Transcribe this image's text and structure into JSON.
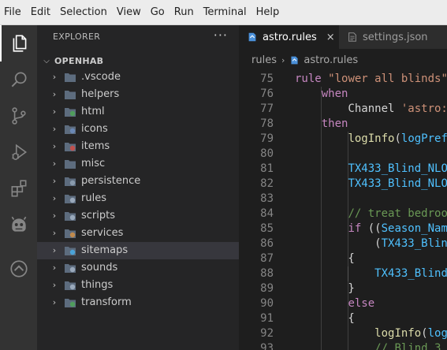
{
  "menubar": {
    "items": [
      "File",
      "Edit",
      "Selection",
      "View",
      "Go",
      "Run",
      "Terminal",
      "Help"
    ]
  },
  "activitybar": {
    "icons": [
      "files-icon",
      "search-icon",
      "source-control-icon",
      "run-debug-icon",
      "extensions-icon",
      "openhab-alien-icon",
      "openhab-logo-icon"
    ]
  },
  "sidebar": {
    "header": "EXPLORER",
    "more": "···",
    "root": "OPENHAB",
    "items": [
      {
        "label": ".vscode",
        "icon": "folder-vscode-icon",
        "color": "#5d6c7e"
      },
      {
        "label": "helpers",
        "icon": "folder-icon",
        "color": "#5d6c7e"
      },
      {
        "label": "html",
        "icon": "folder-html-icon",
        "color": "#4f9d5c"
      },
      {
        "label": "icons",
        "icon": "folder-icons-icon",
        "color": "#6a88b5"
      },
      {
        "label": "items",
        "icon": "folder-items-icon",
        "color": "#c0504d"
      },
      {
        "label": "misc",
        "icon": "folder-icon",
        "color": "#5d6c7e"
      },
      {
        "label": "persistence",
        "icon": "folder-persistence-icon",
        "color": "#8a9bad"
      },
      {
        "label": "rules",
        "icon": "folder-rules-icon",
        "color": "#9aa9bb"
      },
      {
        "label": "scripts",
        "icon": "folder-scripts-icon",
        "color": "#9aa9bb"
      },
      {
        "label": "services",
        "icon": "folder-services-icon",
        "color": "#c08a4d"
      },
      {
        "label": "sitemaps",
        "icon": "folder-sitemaps-icon",
        "color": "#4aa3d9"
      },
      {
        "label": "sounds",
        "icon": "folder-sounds-icon",
        "color": "#9aa9bb"
      },
      {
        "label": "things",
        "icon": "folder-things-icon",
        "color": "#9aa9bb"
      },
      {
        "label": "transform",
        "icon": "folder-transform-icon",
        "color": "#4f9d5c"
      }
    ],
    "selected": "sitemaps"
  },
  "editor": {
    "tabs": [
      {
        "label": "astro.rules",
        "active": true,
        "close": "×"
      },
      {
        "label": "settings.json",
        "active": false
      }
    ],
    "breadcrumb": {
      "folder": "rules",
      "file": "astro.rules"
    },
    "lines": [
      {
        "n": "75",
        "tokens": [
          [
            "k",
            "rule "
          ],
          [
            "s",
            "\"lower all blinds\""
          ]
        ]
      },
      {
        "n": "76",
        "tokens": [
          [
            "p",
            "    "
          ],
          [
            "k",
            "when"
          ]
        ]
      },
      {
        "n": "77",
        "tokens": [
          [
            "p",
            "        Channel "
          ],
          [
            "s",
            "'astro:"
          ]
        ]
      },
      {
        "n": "78",
        "tokens": [
          [
            "p",
            "    "
          ],
          [
            "k",
            "then"
          ]
        ]
      },
      {
        "n": "79",
        "tokens": [
          [
            "p",
            "        "
          ],
          [
            "f",
            "logInfo"
          ],
          [
            "p",
            "("
          ],
          [
            "v",
            "logPref"
          ]
        ]
      },
      {
        "n": "80",
        "tokens": [
          [
            "p",
            ""
          ]
        ]
      },
      {
        "n": "81",
        "tokens": [
          [
            "p",
            "        "
          ],
          [
            "v",
            "TX433_Blind_NLO"
          ]
        ]
      },
      {
        "n": "82",
        "tokens": [
          [
            "p",
            "        "
          ],
          [
            "v",
            "TX433_Blind_NLO"
          ]
        ]
      },
      {
        "n": "83",
        "tokens": [
          [
            "p",
            ""
          ]
        ]
      },
      {
        "n": "84",
        "tokens": [
          [
            "p",
            "        "
          ],
          [
            "c",
            "// treat bedroo"
          ]
        ]
      },
      {
        "n": "85",
        "tokens": [
          [
            "p",
            "        "
          ],
          [
            "k",
            "if"
          ],
          [
            "p",
            " (("
          ],
          [
            "v",
            "Season_Nam"
          ]
        ]
      },
      {
        "n": "86",
        "tokens": [
          [
            "p",
            "            ("
          ],
          [
            "v",
            "TX433_Blin"
          ]
        ]
      },
      {
        "n": "87",
        "tokens": [
          [
            "p",
            "        {"
          ]
        ]
      },
      {
        "n": "88",
        "tokens": [
          [
            "p",
            "            "
          ],
          [
            "v",
            "TX433_Blind"
          ]
        ]
      },
      {
        "n": "89",
        "tokens": [
          [
            "p",
            "        }"
          ]
        ]
      },
      {
        "n": "90",
        "tokens": [
          [
            "p",
            "        "
          ],
          [
            "k",
            "else"
          ]
        ]
      },
      {
        "n": "91",
        "tokens": [
          [
            "p",
            "        {"
          ]
        ]
      },
      {
        "n": "92",
        "tokens": [
          [
            "p",
            "            "
          ],
          [
            "f",
            "logInfo"
          ],
          [
            "p",
            "("
          ],
          [
            "v",
            "log"
          ]
        ]
      },
      {
        "n": "93",
        "tokens": [
          [
            "p",
            "            "
          ],
          [
            "c",
            "// Blind 3"
          ]
        ]
      }
    ]
  }
}
